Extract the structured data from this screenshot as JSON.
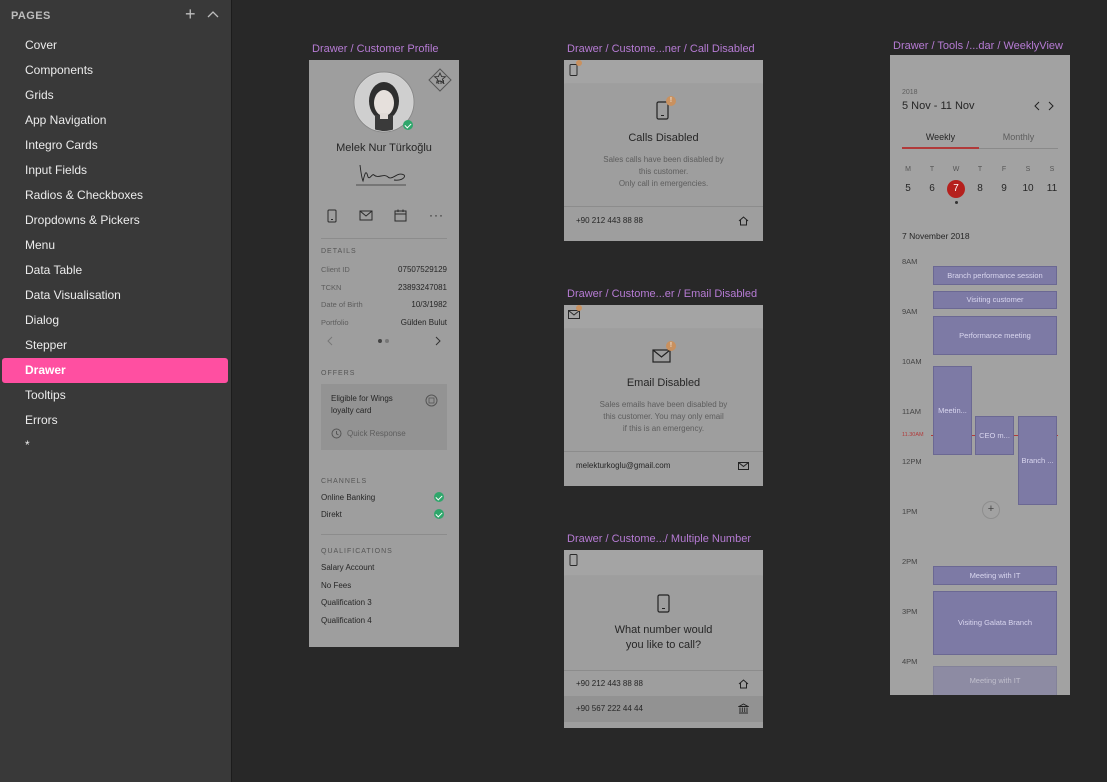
{
  "sidebar": {
    "title": "PAGES",
    "add_icon": "plus-icon",
    "collapse_icon": "chevron-up-icon",
    "items": [
      {
        "label": "Cover",
        "active": false
      },
      {
        "label": "Components",
        "active": false
      },
      {
        "label": "Grids",
        "active": false
      },
      {
        "label": "App Navigation",
        "active": false
      },
      {
        "label": "Integro Cards",
        "active": false
      },
      {
        "label": "Input Fields",
        "active": false
      },
      {
        "label": "Radios & Checkboxes",
        "active": false
      },
      {
        "label": "Dropdowns & Pickers",
        "active": false
      },
      {
        "label": "Menu",
        "active": false
      },
      {
        "label": "Data Table",
        "active": false
      },
      {
        "label": "Data Visualisation",
        "active": false
      },
      {
        "label": "Dialog",
        "active": false
      },
      {
        "label": "Stepper",
        "active": false
      },
      {
        "label": "Drawer",
        "active": true
      },
      {
        "label": "Tooltips",
        "active": false
      },
      {
        "label": "Errors",
        "active": false
      },
      {
        "label": "*",
        "active": false
      }
    ],
    "active_color": "#ff4fa1"
  },
  "artboards": {
    "profile": {
      "title": "Drawer / Customer Profile",
      "badge": "1x1",
      "name": "Melek Nur Türkoğlu",
      "details_label": "DETAILS",
      "details": [
        {
          "label": "Client ID",
          "value": "07507529129"
        },
        {
          "label": "TCKN",
          "value": "23893247081"
        },
        {
          "label": "Date of Birth",
          "value": "10/3/1982"
        },
        {
          "label": "Portfolio",
          "value": "Gülden Bulut"
        }
      ],
      "offers_label": "OFFERS",
      "offer_text_1": "Eligible for Wings",
      "offer_text_2": "loyalty card",
      "offer_action": "Quick Response",
      "channels_label": "CHANNELS",
      "channels": [
        "Online Banking",
        "Direkt"
      ],
      "qualifications_label": "QUALIFICATIONS",
      "qualifications": [
        "Salary Account",
        "No Fees",
        "Qualification 3",
        "Qualification 4"
      ]
    },
    "call_disabled": {
      "title": "Drawer / Custome...ner / Call Disabled",
      "heading": "Calls Disabled",
      "line1": "Sales calls have been disabled by",
      "line2": "this customer.",
      "line3": "Only call in emergencies.",
      "phone": "+90 212 443 88 88"
    },
    "email_disabled": {
      "title": "Drawer / Custome...er / Email Disabled",
      "heading": "Email Disabled",
      "line1": "Sales emails have been disabled by",
      "line2": "this customer. You may only email",
      "line3": "if this is an emergency.",
      "email": "melekturkoglu@gmail.com"
    },
    "multiple_number": {
      "title": "Drawer / Custome.../ Multiple Number",
      "heading_1": "What number would",
      "heading_2": "you like to call?",
      "numbers": [
        "+90 212 443 88 88",
        "+90 567 222 44 44"
      ]
    },
    "weekly": {
      "title": "Drawer / Tools /...dar / WeeklyView",
      "year": "2018",
      "range": "5 Nov - 11 Nov",
      "tabs": [
        "Weekly",
        "Monthly"
      ],
      "day_letters": [
        "M",
        "T",
        "W",
        "T",
        "F",
        "S",
        "S"
      ],
      "day_numbers": [
        "5",
        "6",
        "7",
        "8",
        "9",
        "10",
        "11"
      ],
      "selected_day": "7",
      "date_heading": "7 November 2018",
      "hours": [
        "8AM",
        "9AM",
        "10AM",
        "11AM",
        "11.30AM",
        "12PM",
        "1PM",
        "2PM",
        "3PM",
        "4PM"
      ],
      "events": [
        "Branch performance session",
        "Visiting customer",
        "Performance meeting",
        "Meetin...",
        "CEO m...",
        "Branch ...",
        "Meeting with IT",
        "Visiting Galata Branch",
        "Meeting with IT"
      ],
      "now_color": "#b13a3a",
      "selected_color": "#b5201d"
    }
  }
}
